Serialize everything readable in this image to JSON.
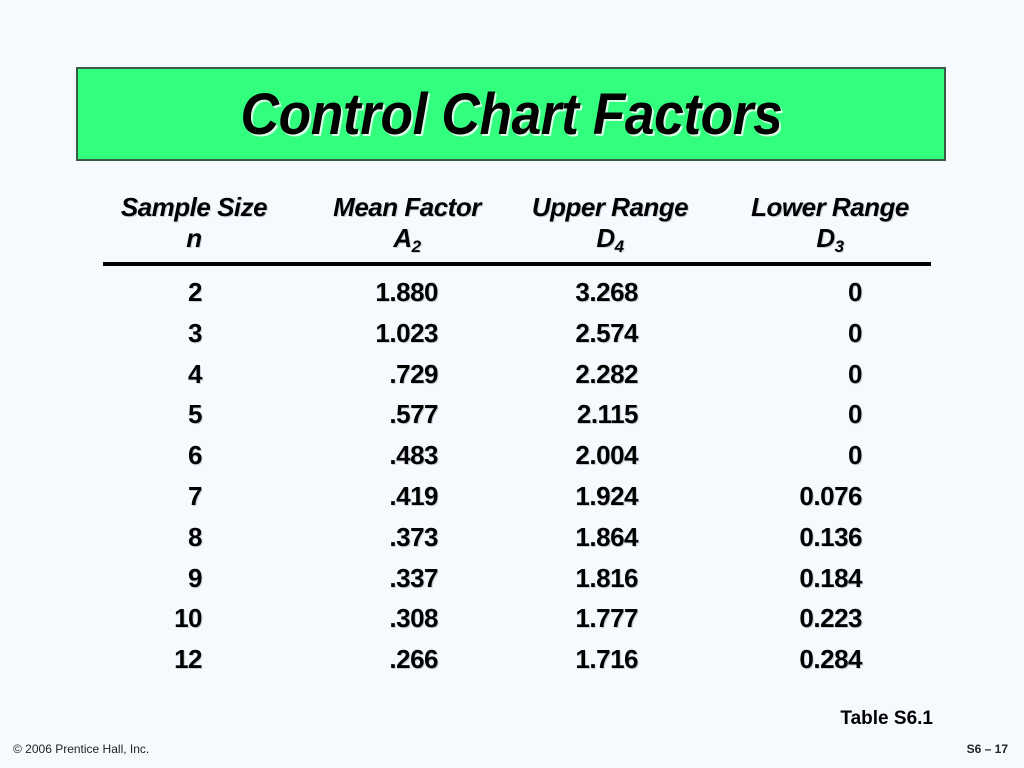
{
  "slide": {
    "title": "Control Chart Factors",
    "title_bg_color": "#33ff7f",
    "table_label": "Table S6.1",
    "copyright": "© 2006 Prentice Hall, Inc.",
    "page_number": "S6 – 17"
  },
  "table": {
    "headers": [
      {
        "line1": "Sample Size",
        "symbol": "n",
        "sub": ""
      },
      {
        "line1": "Mean Factor",
        "symbol": "A",
        "sub": "2"
      },
      {
        "line1": "Upper Range",
        "symbol": "D",
        "sub": "4"
      },
      {
        "line1": "Lower Range",
        "symbol": "D",
        "sub": "3"
      }
    ],
    "rows": [
      {
        "n": "2",
        "a2": "1.880",
        "d4": "3.268",
        "d3": "0"
      },
      {
        "n": "3",
        "a2": "1.023",
        "d4": "2.574",
        "d3": "0"
      },
      {
        "n": "4",
        "a2": ".729",
        "d4": "2.282",
        "d3": "0"
      },
      {
        "n": "5",
        "a2": ".577",
        "d4": "2.115",
        "d3": "0"
      },
      {
        "n": "6",
        "a2": ".483",
        "d4": "2.004",
        "d3": "0"
      },
      {
        "n": "7",
        "a2": ".419",
        "d4": "1.924",
        "d3": "0.076"
      },
      {
        "n": "8",
        "a2": ".373",
        "d4": "1.864",
        "d3": "0.136"
      },
      {
        "n": "9",
        "a2": ".337",
        "d4": "1.816",
        "d3": "0.184"
      },
      {
        "n": "10",
        "a2": ".308",
        "d4": "1.777",
        "d3": "0.223"
      },
      {
        "n": "12",
        "a2": ".266",
        "d4": "1.716",
        "d3": "0.284"
      }
    ]
  }
}
